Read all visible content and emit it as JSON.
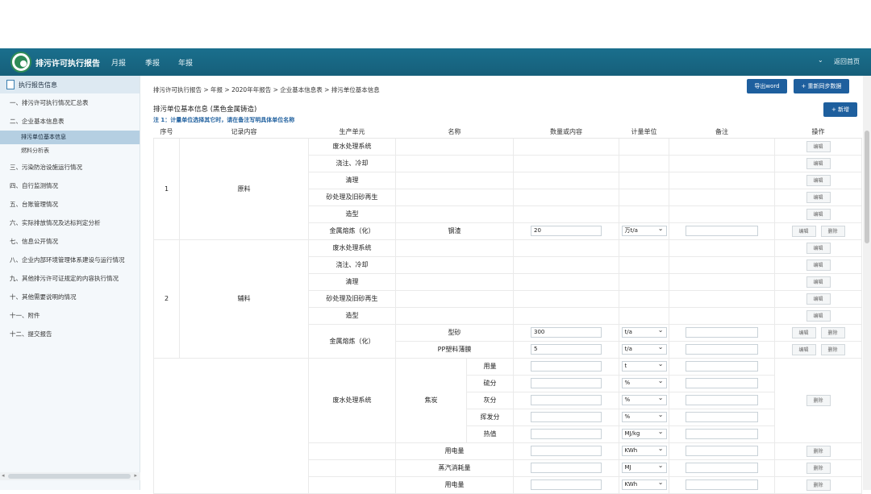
{
  "nav": {
    "brand": "排污许可执行报告",
    "links": [
      "月报",
      "季报",
      "年报"
    ],
    "back": "返回首页"
  },
  "sidebar": {
    "header": "执行报告信息",
    "items": [
      "一、排污许可执行情况汇总表",
      "二、企业基本信息表",
      "三、污染防治设施运行情况",
      "四、自行监测情况",
      "五、台账管理情况",
      "六、实际排放情况及达标判定分析",
      "七、信息公开情况",
      "八、企业内部环境管理体系建设与运行情况",
      "九、其他排污许可证规定的内容执行情况",
      "十、其他需要说明的情况",
      "十一、附件",
      "十二、提交报告"
    ],
    "subitems": [
      "排污单位基本信息",
      "燃料分析表"
    ]
  },
  "main": {
    "breadcrumb": "排污许可执行报告 > 年报 > 2020年年报告 > 企业基本信息表 > 排污单位基本信息",
    "export_btn": "导出word",
    "sync_btn": "+ 重新同步数据",
    "add_btn": "+ 新增",
    "title": "排污单位基本信息 (黑色金属铸造)",
    "note": "注 1：计量单位选择其它时，请在备注写明具体单位名称",
    "headers": [
      "序号",
      "记录内容",
      "生产单元",
      "名称",
      "数量或内容",
      "计量单位",
      "备注",
      "操作"
    ],
    "edit": "编辑",
    "delete": "删除",
    "rows": {
      "g1_no": "1",
      "g1_type": "原料",
      "g2_no": "2",
      "g2_type": "辅料",
      "units": [
        "废水处理系统",
        "浇注、冷却",
        "清理",
        "砂处理及旧砂再生",
        "造型",
        "金属熔炼（化）"
      ],
      "g1_name": "钢渣",
      "g1_qty": "20",
      "g1_unit": "万t/a",
      "g2_name1": "型砂",
      "g2_qty1": "300",
      "g2_unit1": "t/a",
      "g2_name2": "PP塑料薄膜",
      "g2_qty2": "5",
      "g2_unit2": "t/a",
      "g3_unit": "废水处理系统",
      "coke": "焦炭",
      "coke_items": [
        "用量",
        "硫分",
        "灰分",
        "挥发分",
        "热值"
      ],
      "coke_units": [
        "t",
        "%",
        "%",
        "%",
        "MJ/kg"
      ],
      "elec": "用电量",
      "elec_unit": "KWh",
      "steam": "蒸汽消耗量",
      "steam_unit": "MJ",
      "elec2": "用电量",
      "elec2_unit": "KWh"
    }
  }
}
